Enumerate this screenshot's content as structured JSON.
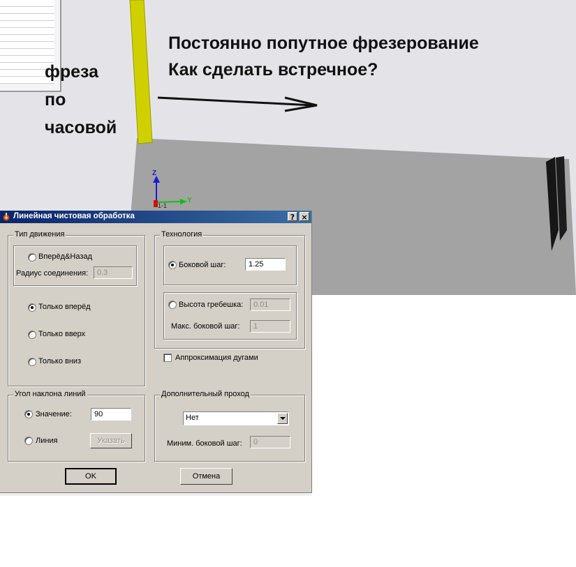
{
  "annotations": {
    "question_line1": "Постоянно попутное фрезерование",
    "question_line2": "Как сделать встречное?",
    "cutter_line1": "фреза",
    "cutter_line2": "по",
    "cutter_line3": "часовой"
  },
  "viewport": {
    "axis_z_label": "Z",
    "axis_y_label": "Y",
    "origin_label": "1-1",
    "colors": {
      "background": "#e4e4e8",
      "tool": "#d2d200",
      "part": "#a2a2a2",
      "arrow": "#111111"
    }
  },
  "dialog": {
    "title": "Линейная чистовая обработка",
    "help_button": "?",
    "close_button": "×",
    "movement": {
      "legend": "Тип движения",
      "forward_back_label": "Вперёд&Назад",
      "link_radius_label": "Радиус соединения:",
      "link_radius_value": "0.3",
      "forward_only_label": "Только вперёд",
      "up_only_label": "Только вверх",
      "down_only_label": "Только вниз",
      "selected": "forward_only"
    },
    "technology": {
      "legend": "Технология",
      "stepover_label": "Боковой шаг:",
      "stepover_value": "1.25",
      "scallop_label": "Высота гребешка:",
      "scallop_value": "0.01",
      "max_stepover_label": "Макс. боковой шаг:",
      "max_stepover_value": "1",
      "selected": "stepover"
    },
    "arc_fit": {
      "label": "Аппроксимация дугами",
      "checked": false
    },
    "angle": {
      "legend": "Угол наклона линий",
      "value_label": "Значение:",
      "value": "90",
      "line_label": "Линия",
      "pick_button": "Указать",
      "selected": "value"
    },
    "extra_pass": {
      "legend": "Дополнительный проход",
      "selected_option": "Нет",
      "min_stepover_label": "Миним. боковой шаг:",
      "min_stepover_value": "0"
    },
    "ok_button": "OK",
    "cancel_button": "Отмена"
  }
}
